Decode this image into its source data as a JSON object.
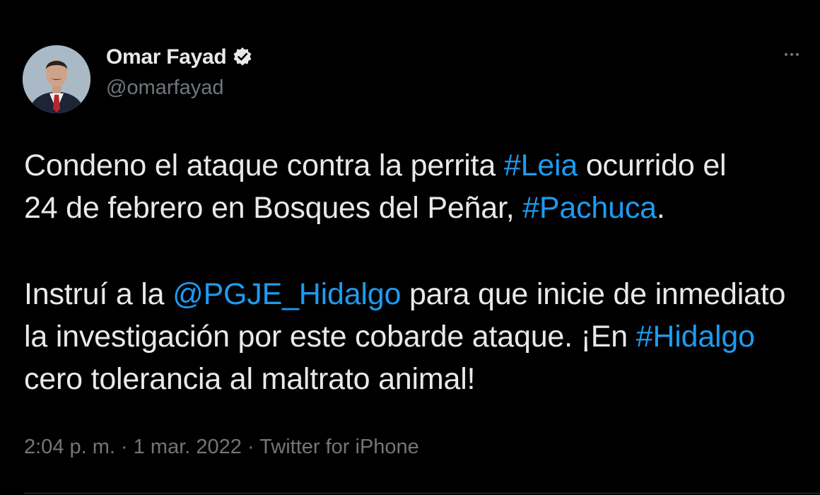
{
  "author": {
    "display_name": "Omar Fayad",
    "handle": "@omarfayad",
    "verified": true,
    "avatar_icon": "profile-photo"
  },
  "tweet": {
    "line1": {
      "pre": "Condeno el ataque contra la perrita ",
      "tag": "#Leia",
      "post": " ocurrido el"
    },
    "line2": {
      "pre": "24 de febrero en Bosques del Peñar, ",
      "tag": "#Pachuca",
      "post": "."
    },
    "line3": {
      "pre": "Instruí a la ",
      "mention": "@PGJE_Hidalgo",
      "post": " para que inicie de inmediato"
    },
    "line4": {
      "pre": "la investigación por este cobarde ataque. ¡En ",
      "tag": "#Hidalgo"
    },
    "line5": {
      "text": "cero tolerancia al maltrato animal!"
    }
  },
  "meta": {
    "time": "2:04 p. m.",
    "separator": " · ",
    "date": "1 mar. 2022",
    "source": "Twitter for iPhone"
  },
  "colors": {
    "background": "#000000",
    "text": "#e7e9ea",
    "muted": "#71767b",
    "link": "#1d9bf0"
  }
}
